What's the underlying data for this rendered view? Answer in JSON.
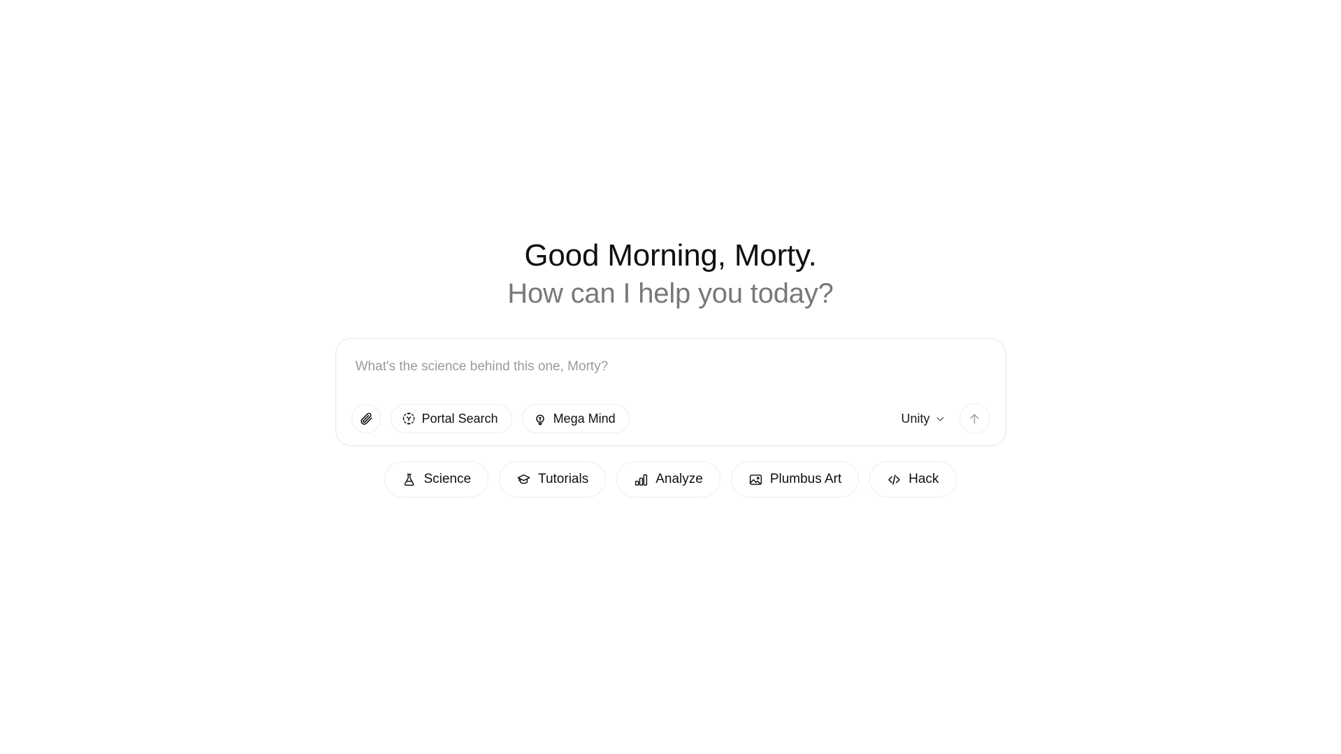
{
  "greeting": {
    "title": "Good Morning, Morty.",
    "subtitle": "How can I help you today?"
  },
  "composer": {
    "placeholder": "What's the science behind this one, Morty?",
    "value": "",
    "attach_icon": "paperclip-icon",
    "tools": [
      {
        "label": "Portal Search",
        "icon": "portal-scan-icon"
      },
      {
        "label": "Mega Mind",
        "icon": "lightbulb-icon"
      }
    ],
    "model": {
      "label": "Unity",
      "chevron_icon": "chevron-down-icon"
    },
    "send": {
      "icon": "arrow-up-icon",
      "enabled": false
    }
  },
  "suggestions": [
    {
      "label": "Science",
      "icon": "flask-icon"
    },
    {
      "label": "Tutorials",
      "icon": "graduation-cap-icon"
    },
    {
      "label": "Analyze",
      "icon": "bar-chart-icon"
    },
    {
      "label": "Plumbus Art",
      "icon": "image-icon"
    },
    {
      "label": "Hack",
      "icon": "code-icon"
    }
  ],
  "colors": {
    "background": "#ffffff",
    "text_primary": "#10100f",
    "text_muted": "#78787a",
    "placeholder": "#9b9b9e",
    "border": "#ececeb"
  }
}
